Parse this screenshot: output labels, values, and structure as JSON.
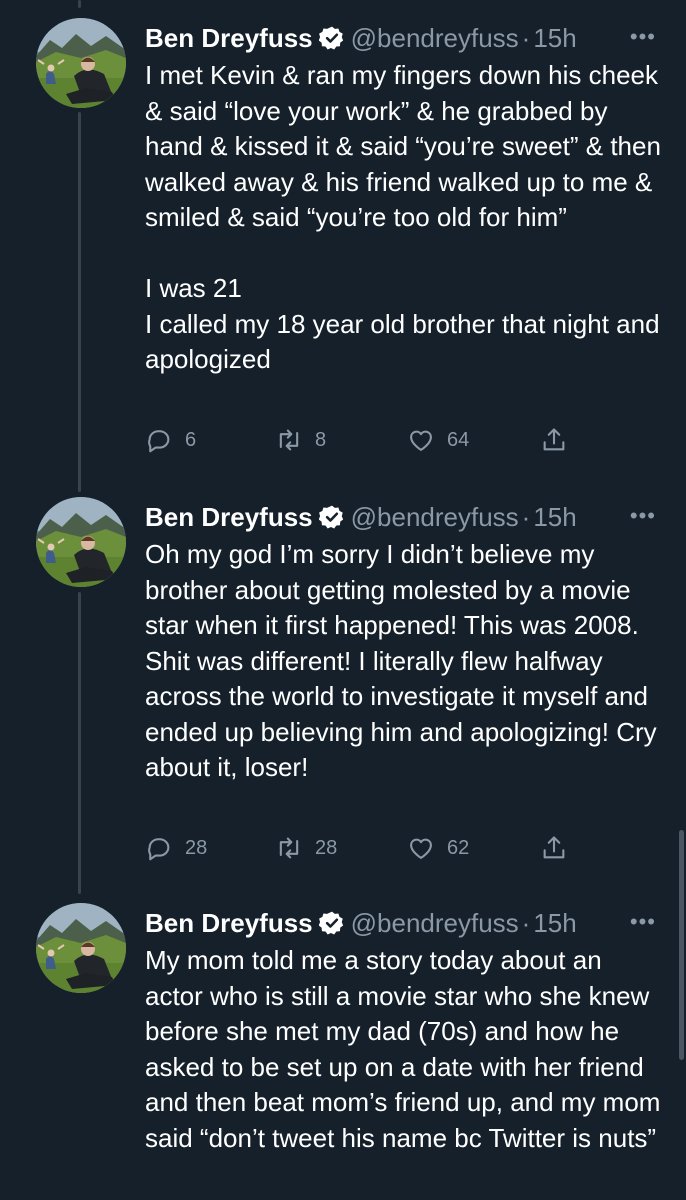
{
  "colors": {
    "background": "#15202b",
    "text": "#ffffff",
    "muted": "#8b98a5",
    "verified": "#ffffff",
    "thread_line": "#38444d"
  },
  "tweets": [
    {
      "author": {
        "name": "Ben Dreyfuss",
        "handle": "@bendreyfuss",
        "verified_icon": "verified-badge-icon",
        "avatar": "profile-photo"
      },
      "separator": "·",
      "time": "15h",
      "more": "•••",
      "paragraphs": [
        "I met Kevin & ran my fingers down his cheek & said “love your work” & he grabbed by hand & kissed it & said “you’re sweet” & then walked away & his friend walked up to me & smiled & said “you’re too old for him”",
        "I was 21",
        "I called my 18 year old brother that night and apologized"
      ],
      "replies": "6",
      "retweets": "8",
      "likes": "64"
    },
    {
      "author": {
        "name": "Ben Dreyfuss",
        "handle": "@bendreyfuss",
        "verified_icon": "verified-badge-icon",
        "avatar": "profile-photo"
      },
      "separator": "·",
      "time": "15h",
      "more": "•••",
      "paragraphs": [
        "Oh my god I’m sorry I didn’t believe my brother about getting molested by a movie star when it first happened! This was 2008. Shit was different! I literally flew halfway across the world to investigate it myself and ended up believing him and apologizing! Cry about it, loser!"
      ],
      "replies": "28",
      "retweets": "28",
      "likes": "62"
    },
    {
      "author": {
        "name": "Ben Dreyfuss",
        "handle": "@bendreyfuss",
        "verified_icon": "verified-badge-icon",
        "avatar": "profile-photo"
      },
      "separator": "·",
      "time": "15h",
      "more": "•••",
      "paragraphs": [
        "My mom told me a story today about an actor who is still a movie star who she knew before she met my dad (70s) and how he asked to be set up on a date with her friend and then beat mom’s friend up, and my mom said “don’t tweet his name bc Twitter is nuts”"
      ]
    }
  ]
}
